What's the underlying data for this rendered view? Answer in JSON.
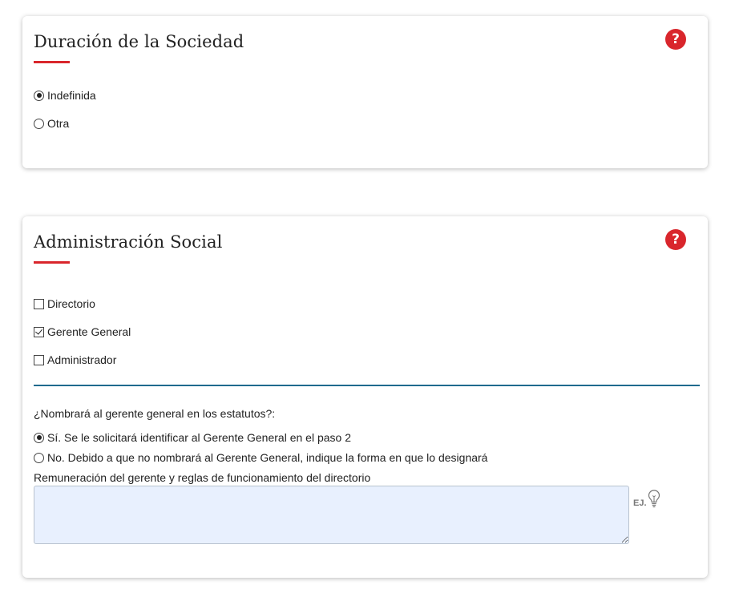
{
  "duracion": {
    "title": "Duración de la Sociedad",
    "help": "?",
    "options": [
      {
        "label": "Indefinida",
        "checked": true
      },
      {
        "label": "Otra",
        "checked": false
      }
    ]
  },
  "administracion": {
    "title": "Administración Social",
    "help": "?",
    "options": [
      {
        "label": "Directorio",
        "checked": false
      },
      {
        "label": "Gerente General",
        "checked": true
      },
      {
        "label": "Administrador",
        "checked": false
      }
    ],
    "question": "¿Nombrará al gerente general en los estatutos?:",
    "answers": [
      {
        "label": "Sí. Se le solicitará identificar al Gerente General en el paso 2",
        "checked": true
      },
      {
        "label": "No. Debido a que no nombrará al Gerente General, indique la forma en que lo designará",
        "checked": false
      }
    ],
    "textarea_label": "Remuneración del gerente y reglas de funcionamiento del directorio",
    "textarea_value": "",
    "hint_label": "EJ."
  },
  "colors": {
    "accent": "#d9262c",
    "divider": "#1f6a8e",
    "textarea_bg": "#e8f0fe"
  },
  "icons": [
    "question-circle-icon",
    "lightbulb-icon"
  ]
}
